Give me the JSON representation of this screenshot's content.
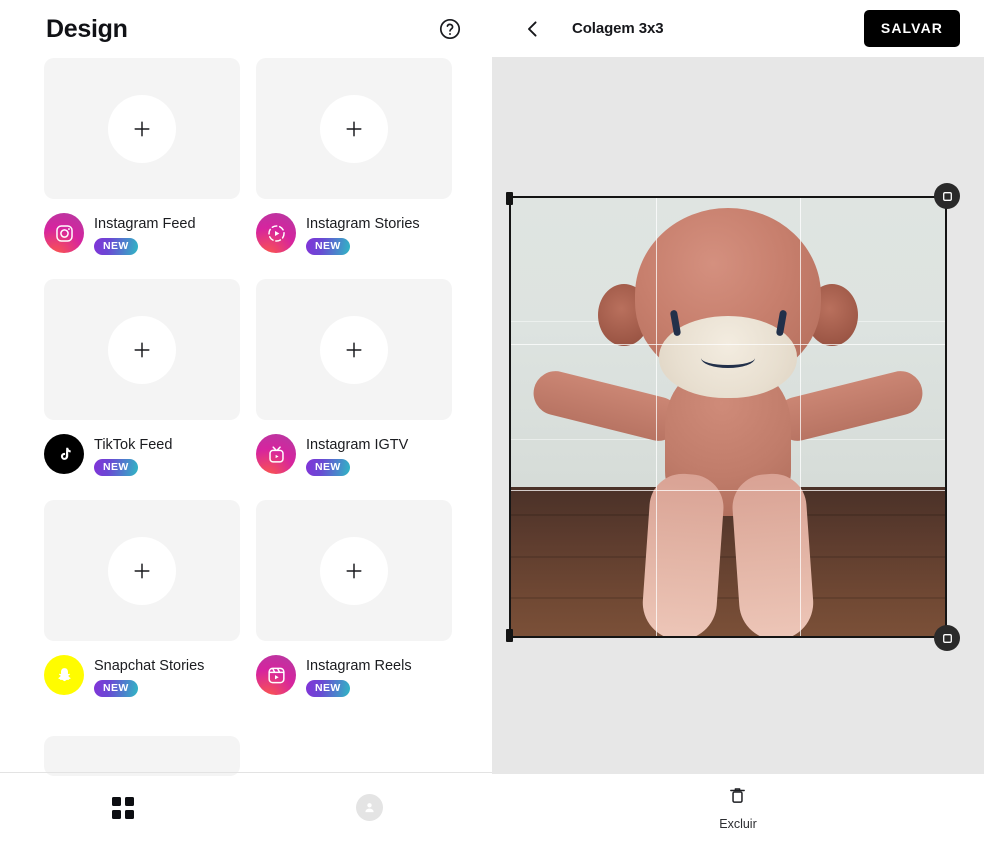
{
  "left_panel": {
    "title": "Design",
    "help_icon": "help-circle-icon",
    "cards": [
      {
        "label": "Instagram Feed",
        "badge": "NEW",
        "icon": "instagram-feed-icon",
        "brand": "instagram",
        "add_icon": "plus-icon"
      },
      {
        "label": "Instagram Stories",
        "badge": "NEW",
        "icon": "instagram-stories-icon",
        "brand": "instagram",
        "add_icon": "plus-icon"
      },
      {
        "label": "TikTok Feed",
        "badge": "NEW",
        "icon": "tiktok-icon",
        "brand": "tiktok",
        "add_icon": "plus-icon"
      },
      {
        "label": "Instagram IGTV",
        "badge": "NEW",
        "icon": "instagram-igtv-icon",
        "brand": "instagram",
        "add_icon": "plus-icon"
      },
      {
        "label": "Snapchat Stories",
        "badge": "NEW",
        "icon": "snapchat-icon",
        "brand": "snapchat",
        "add_icon": "plus-icon"
      },
      {
        "label": "Instagram Reels",
        "badge": "NEW",
        "icon": "instagram-reels-icon",
        "brand": "instagram",
        "add_icon": "plus-icon"
      }
    ],
    "bottom_nav": [
      {
        "name": "templates-tab",
        "icon": "grid-icon",
        "active": true
      },
      {
        "name": "profile-tab",
        "icon": "person-icon",
        "active": false
      }
    ]
  },
  "right_panel": {
    "back_icon": "chevron-left-icon",
    "title": "Colagem 3x3",
    "save_label": "SALVAR",
    "canvas": {
      "crop_grid": "3x3",
      "photo_subject": "crocheted-monkey-doll-photo",
      "handle_icon": "resize-handle-icon"
    },
    "bottom_bar": {
      "delete_label": "Excluir",
      "delete_icon": "trash-icon"
    }
  },
  "colors": {
    "accent_black": "#000000",
    "badge_gradient_start": "#8233d8",
    "badge_gradient_end": "#2fb8c4",
    "instagram_gradient": "#d6249f",
    "snapchat_yellow": "#fffc00",
    "tiktok_black": "#000000",
    "card_placeholder": "#f4f4f4",
    "canvas_background": "#e7e7e7"
  }
}
